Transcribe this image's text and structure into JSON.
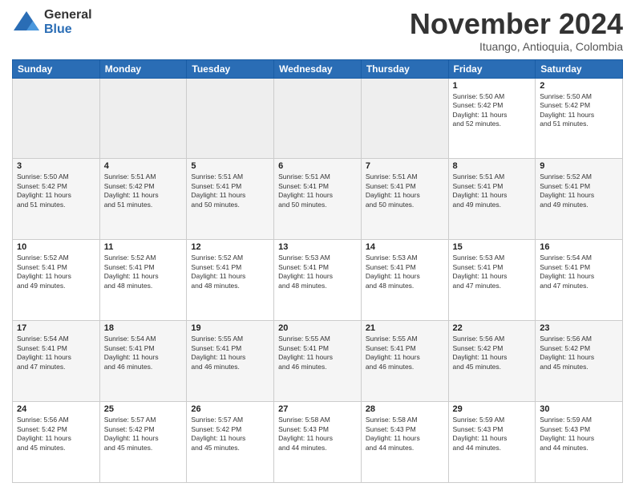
{
  "logo": {
    "general": "General",
    "blue": "Blue"
  },
  "header": {
    "month": "November 2024",
    "location": "Ituango, Antioquia, Colombia"
  },
  "weekdays": [
    "Sunday",
    "Monday",
    "Tuesday",
    "Wednesday",
    "Thursday",
    "Friday",
    "Saturday"
  ],
  "weeks": [
    [
      {
        "day": "",
        "info": ""
      },
      {
        "day": "",
        "info": ""
      },
      {
        "day": "",
        "info": ""
      },
      {
        "day": "",
        "info": ""
      },
      {
        "day": "",
        "info": ""
      },
      {
        "day": "1",
        "info": "Sunrise: 5:50 AM\nSunset: 5:42 PM\nDaylight: 11 hours\nand 52 minutes."
      },
      {
        "day": "2",
        "info": "Sunrise: 5:50 AM\nSunset: 5:42 PM\nDaylight: 11 hours\nand 51 minutes."
      }
    ],
    [
      {
        "day": "3",
        "info": "Sunrise: 5:50 AM\nSunset: 5:42 PM\nDaylight: 11 hours\nand 51 minutes."
      },
      {
        "day": "4",
        "info": "Sunrise: 5:51 AM\nSunset: 5:42 PM\nDaylight: 11 hours\nand 51 minutes."
      },
      {
        "day": "5",
        "info": "Sunrise: 5:51 AM\nSunset: 5:41 PM\nDaylight: 11 hours\nand 50 minutes."
      },
      {
        "day": "6",
        "info": "Sunrise: 5:51 AM\nSunset: 5:41 PM\nDaylight: 11 hours\nand 50 minutes."
      },
      {
        "day": "7",
        "info": "Sunrise: 5:51 AM\nSunset: 5:41 PM\nDaylight: 11 hours\nand 50 minutes."
      },
      {
        "day": "8",
        "info": "Sunrise: 5:51 AM\nSunset: 5:41 PM\nDaylight: 11 hours\nand 49 minutes."
      },
      {
        "day": "9",
        "info": "Sunrise: 5:52 AM\nSunset: 5:41 PM\nDaylight: 11 hours\nand 49 minutes."
      }
    ],
    [
      {
        "day": "10",
        "info": "Sunrise: 5:52 AM\nSunset: 5:41 PM\nDaylight: 11 hours\nand 49 minutes."
      },
      {
        "day": "11",
        "info": "Sunrise: 5:52 AM\nSunset: 5:41 PM\nDaylight: 11 hours\nand 48 minutes."
      },
      {
        "day": "12",
        "info": "Sunrise: 5:52 AM\nSunset: 5:41 PM\nDaylight: 11 hours\nand 48 minutes."
      },
      {
        "day": "13",
        "info": "Sunrise: 5:53 AM\nSunset: 5:41 PM\nDaylight: 11 hours\nand 48 minutes."
      },
      {
        "day": "14",
        "info": "Sunrise: 5:53 AM\nSunset: 5:41 PM\nDaylight: 11 hours\nand 48 minutes."
      },
      {
        "day": "15",
        "info": "Sunrise: 5:53 AM\nSunset: 5:41 PM\nDaylight: 11 hours\nand 47 minutes."
      },
      {
        "day": "16",
        "info": "Sunrise: 5:54 AM\nSunset: 5:41 PM\nDaylight: 11 hours\nand 47 minutes."
      }
    ],
    [
      {
        "day": "17",
        "info": "Sunrise: 5:54 AM\nSunset: 5:41 PM\nDaylight: 11 hours\nand 47 minutes."
      },
      {
        "day": "18",
        "info": "Sunrise: 5:54 AM\nSunset: 5:41 PM\nDaylight: 11 hours\nand 46 minutes."
      },
      {
        "day": "19",
        "info": "Sunrise: 5:55 AM\nSunset: 5:41 PM\nDaylight: 11 hours\nand 46 minutes."
      },
      {
        "day": "20",
        "info": "Sunrise: 5:55 AM\nSunset: 5:41 PM\nDaylight: 11 hours\nand 46 minutes."
      },
      {
        "day": "21",
        "info": "Sunrise: 5:55 AM\nSunset: 5:41 PM\nDaylight: 11 hours\nand 46 minutes."
      },
      {
        "day": "22",
        "info": "Sunrise: 5:56 AM\nSunset: 5:42 PM\nDaylight: 11 hours\nand 45 minutes."
      },
      {
        "day": "23",
        "info": "Sunrise: 5:56 AM\nSunset: 5:42 PM\nDaylight: 11 hours\nand 45 minutes."
      }
    ],
    [
      {
        "day": "24",
        "info": "Sunrise: 5:56 AM\nSunset: 5:42 PM\nDaylight: 11 hours\nand 45 minutes."
      },
      {
        "day": "25",
        "info": "Sunrise: 5:57 AM\nSunset: 5:42 PM\nDaylight: 11 hours\nand 45 minutes."
      },
      {
        "day": "26",
        "info": "Sunrise: 5:57 AM\nSunset: 5:42 PM\nDaylight: 11 hours\nand 45 minutes."
      },
      {
        "day": "27",
        "info": "Sunrise: 5:58 AM\nSunset: 5:43 PM\nDaylight: 11 hours\nand 44 minutes."
      },
      {
        "day": "28",
        "info": "Sunrise: 5:58 AM\nSunset: 5:43 PM\nDaylight: 11 hours\nand 44 minutes."
      },
      {
        "day": "29",
        "info": "Sunrise: 5:59 AM\nSunset: 5:43 PM\nDaylight: 11 hours\nand 44 minutes."
      },
      {
        "day": "30",
        "info": "Sunrise: 5:59 AM\nSunset: 5:43 PM\nDaylight: 11 hours\nand 44 minutes."
      }
    ]
  ]
}
